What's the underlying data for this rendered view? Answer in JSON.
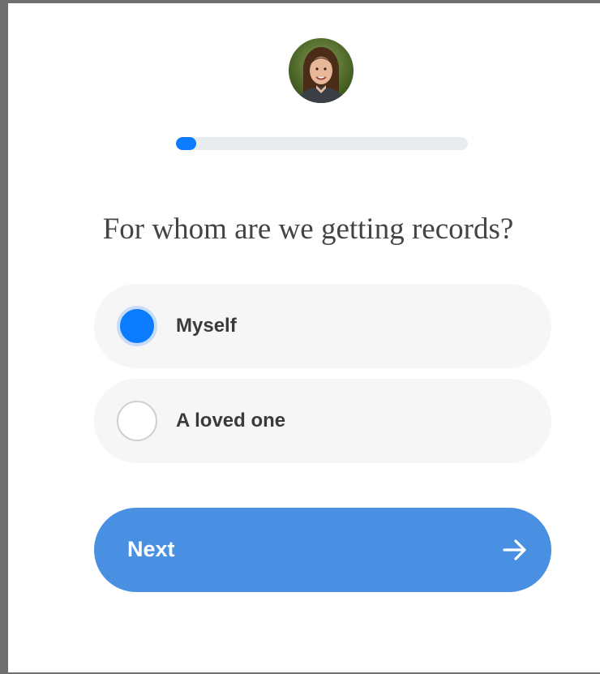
{
  "question": "For whom are we getting records?",
  "progress": {
    "fraction": 0.07,
    "fill_color": "#0b7bff",
    "track_color": "#e9ecef"
  },
  "avatar": {
    "icon": "user-avatar-photo"
  },
  "options": [
    {
      "label": "Myself",
      "selected": true
    },
    {
      "label": "A loved one",
      "selected": false
    }
  ],
  "next_button": {
    "label": "Next",
    "icon": "arrow-right-icon",
    "color": "#4a90e2"
  },
  "colors": {
    "accent": "#0b7bff",
    "option_bg": "#f6f6f6",
    "text": "#444444"
  }
}
